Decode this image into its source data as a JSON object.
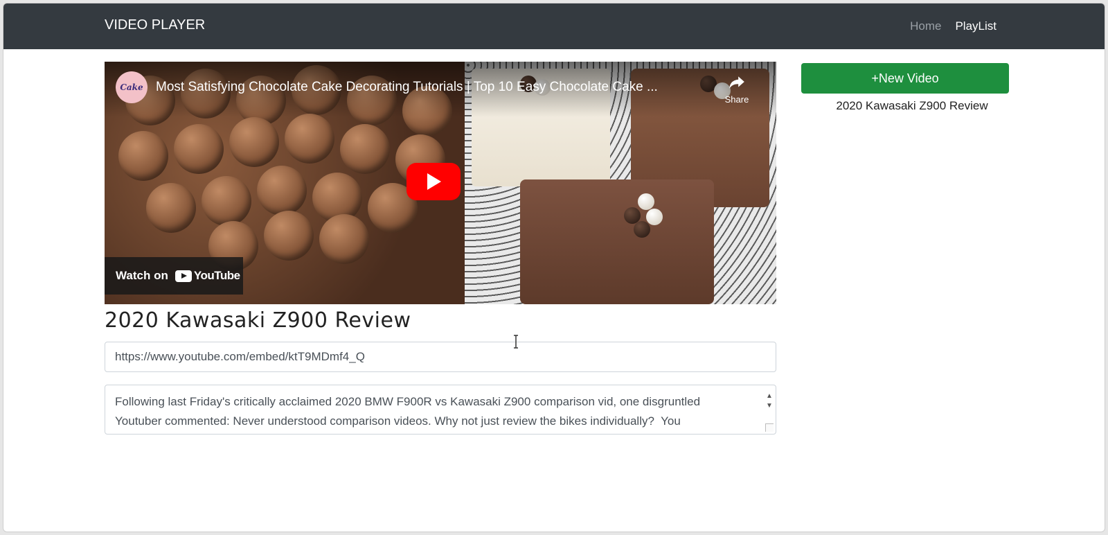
{
  "navbar": {
    "brand": "VIDEO PLAYER",
    "links": [
      {
        "label": "Home",
        "active": false
      },
      {
        "label": "PlayList",
        "active": true
      }
    ]
  },
  "player": {
    "video_title": "Most Satisfying Chocolate Cake Decorating Tutorials | Top 10 Easy Chocolate Cake ...",
    "channel_logo_text": "Cake",
    "share_label": "Share",
    "watch_on_label": "Watch on",
    "youtube_label": "YouTube"
  },
  "main": {
    "title": "2020 Kawasaki Z900 Review",
    "url_value": "https://www.youtube.com/embed/ktT9MDmf4_Q",
    "description": "Following last Friday's critically acclaimed 2020 BMW F900R vs Kawasaki Z900 comparison vid, one disgruntled Youtuber commented: Never understood comparison videos. Why not just review the bikes individually?  You"
  },
  "sidebar": {
    "new_video_label": "+New Video",
    "playlist": [
      {
        "title": "2020 Kawasaki Z900 Review"
      }
    ]
  },
  "colors": {
    "navbar_bg": "#343a40",
    "button_green": "#1e8f3e",
    "youtube_red": "#ff0000"
  }
}
